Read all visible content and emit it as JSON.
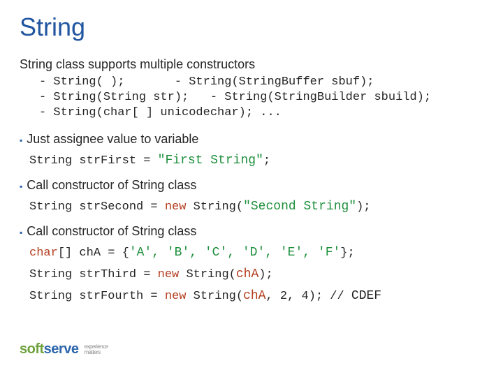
{
  "title": "String",
  "intro": "String class supports multiple constructors",
  "ctors": {
    "line1": "- String( );       - String(StringBuffer sbuf);",
    "line2": "- String(String str);   - String(StringBuilder sbuild);",
    "line3": "- String(char[ ] unicodechar); ..."
  },
  "bullets": {
    "b1": "Just assignee value to variable",
    "b2": " Call constructor of String class",
    "b3": " Call constructor of String class"
  },
  "code": {
    "c1a": "String strFirst = ",
    "c1b": "\"First String\"",
    "c1c": ";",
    "c2a": "String strSecond = ",
    "c2kw": "new",
    "c2b": " String(",
    "c2lit": "\"Second String\"",
    "c2c": ");",
    "c3kw": "char",
    "c3a": "[] chA = {",
    "c3lits": "'A', 'B', 'C', 'D', 'E', 'F'",
    "c3b": "};",
    "c4a": "String strThird = ",
    "c4kw": "new",
    "c4b": " String(",
    "c4var": "chA",
    "c4c": ");",
    "c5a": "String strFourth = ",
    "c5kw": "new",
    "c5b": " String(",
    "c5var": "chA",
    "c5c": ", 2, 4); // ",
    "c5cmt": "CDEF"
  },
  "logo": {
    "soft": "soft",
    "serve": "serve",
    "tag1": "experience",
    "tag2": "matters"
  }
}
